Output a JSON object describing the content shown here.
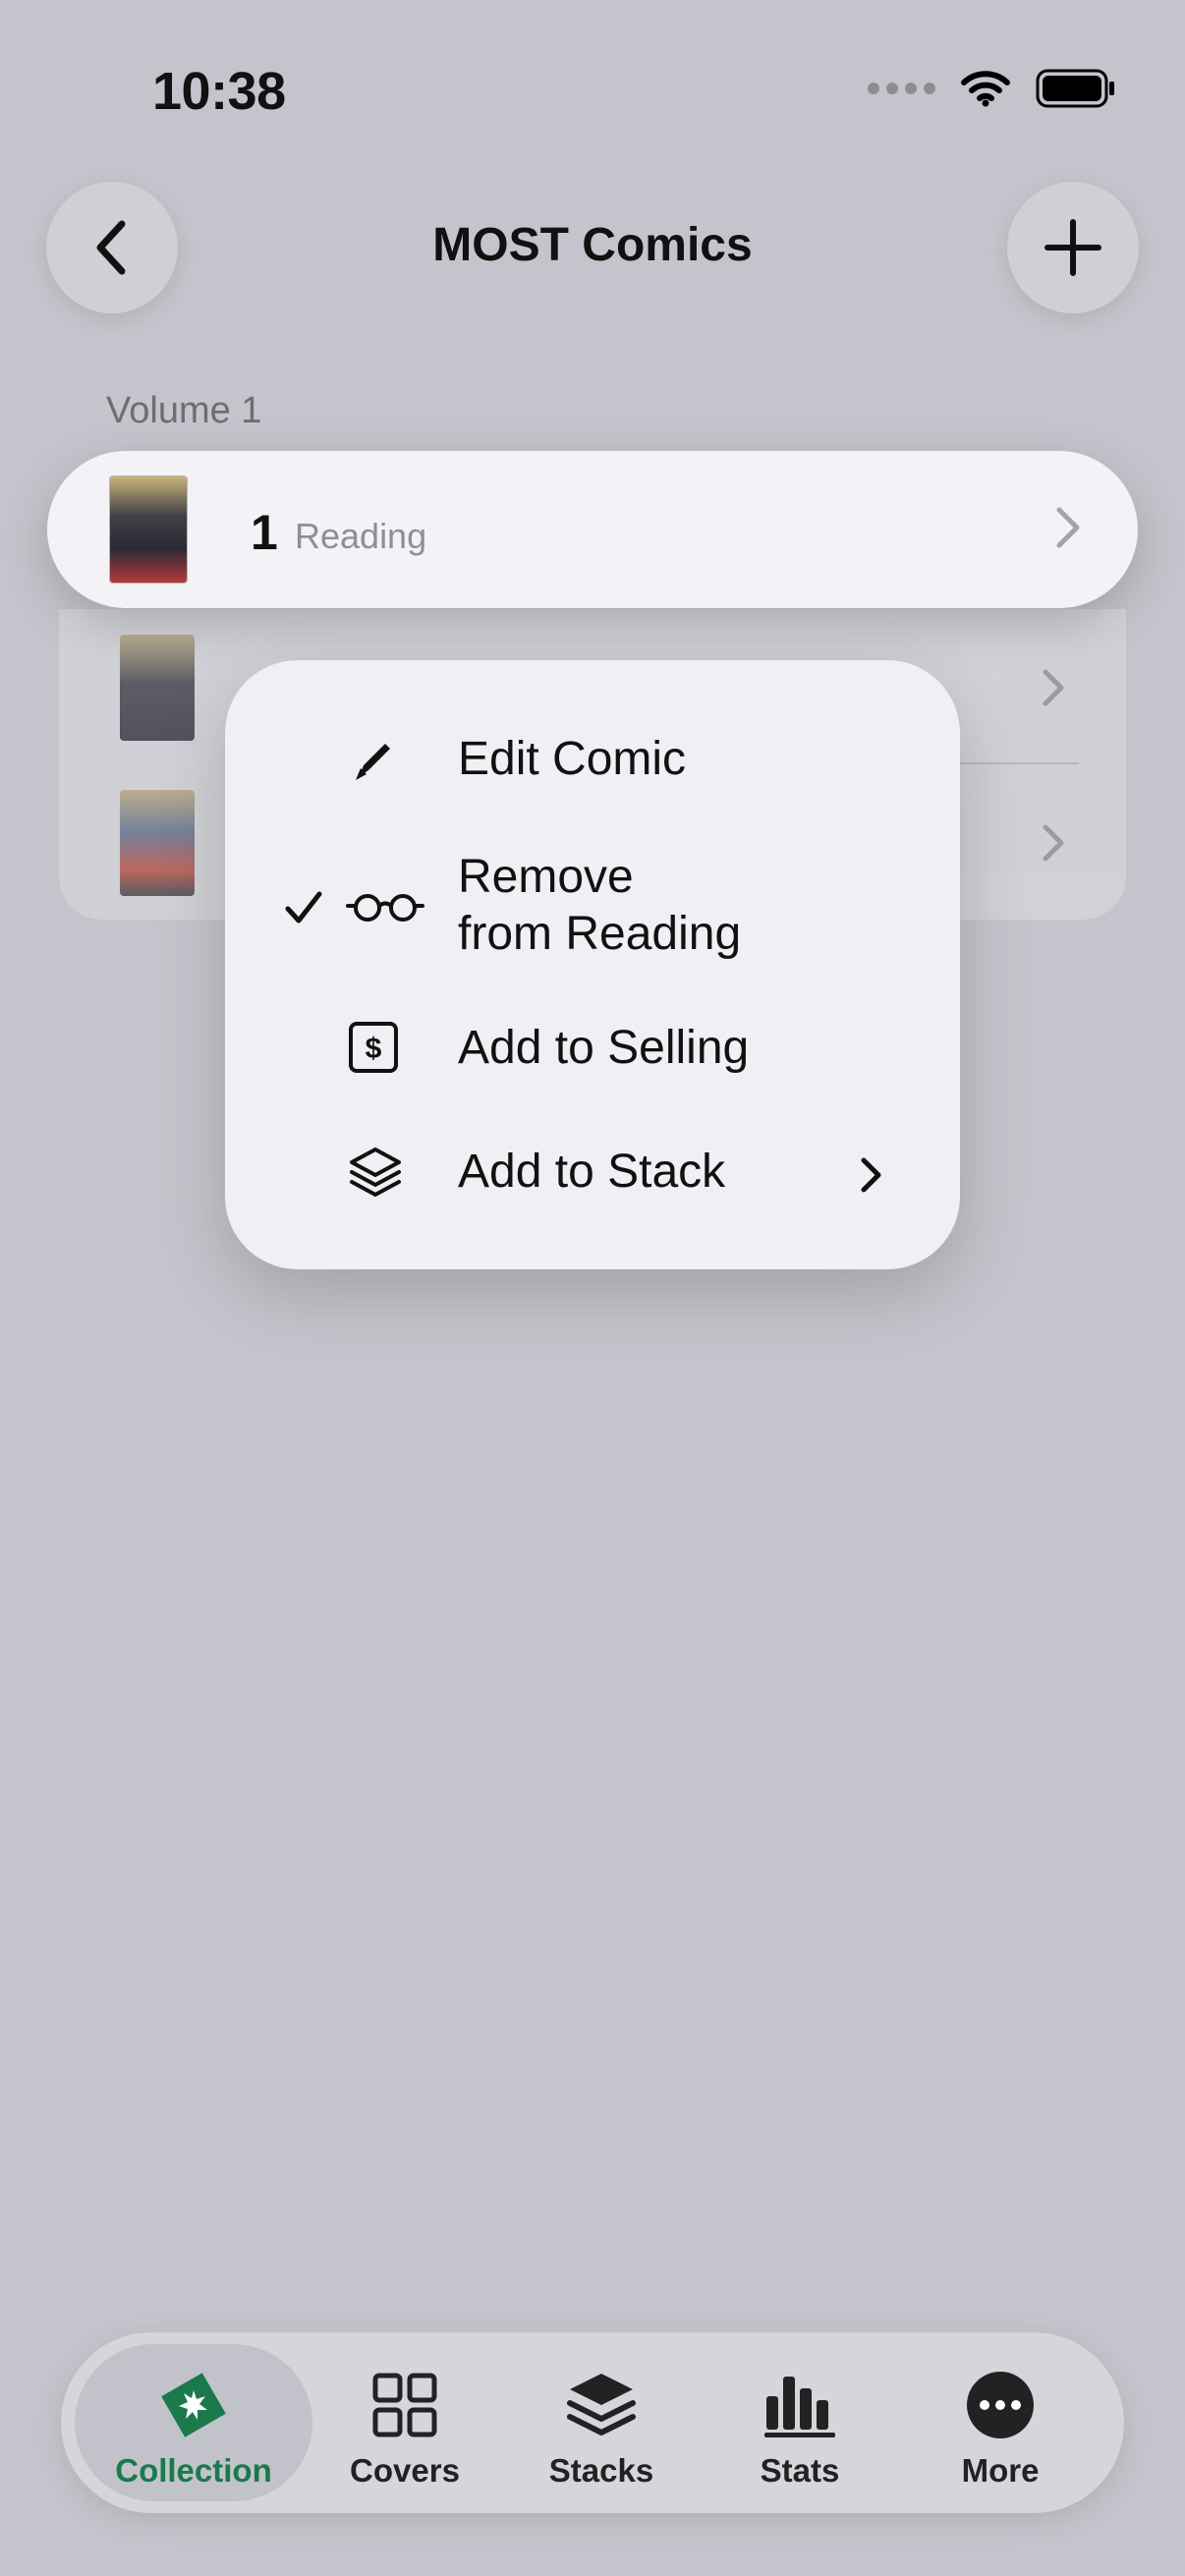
{
  "status_bar": {
    "time": "10:38"
  },
  "nav": {
    "title": "MOST Comics",
    "back_icon": "chevron-left-icon",
    "add_icon": "plus-icon"
  },
  "section": {
    "label": "Volume 1"
  },
  "focused_row": {
    "issue_number": "1",
    "status": "Reading"
  },
  "context_menu": {
    "items": [
      {
        "label": "Edit Comic",
        "icon": "pencil-icon",
        "checked": false
      },
      {
        "label_line1": "Remove",
        "label_line2": "from Reading",
        "icon": "glasses-icon",
        "checked": true
      },
      {
        "label": "Add to Selling",
        "icon": "dollar-icon",
        "checked": false
      },
      {
        "label": "Add to Stack",
        "icon": "stack-icon",
        "checked": false,
        "has_submenu": true
      }
    ]
  },
  "tab_bar": {
    "active_color": "#1b7a4c",
    "tabs": [
      {
        "label": "Collection",
        "icon": "collection-icon",
        "active": true
      },
      {
        "label": "Covers",
        "icon": "covers-grid-icon",
        "active": false
      },
      {
        "label": "Stacks",
        "icon": "stacks-icon",
        "active": false
      },
      {
        "label": "Stats",
        "icon": "stats-icon",
        "active": false
      },
      {
        "label": "More",
        "icon": "more-icon",
        "active": false
      }
    ]
  }
}
